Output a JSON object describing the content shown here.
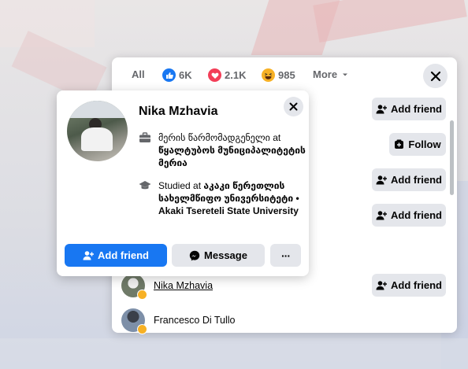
{
  "reactions_dialog": {
    "tabs": [
      {
        "label": "All"
      },
      {
        "label": "6K",
        "icon": "like-reaction-icon",
        "color": "#1877f2"
      },
      {
        "label": "2.1K",
        "icon": "love-reaction-icon",
        "color": "#f33e58"
      },
      {
        "label": "985",
        "icon": "haha-reaction-icon",
        "color": "#f7b125"
      },
      {
        "label": "More",
        "icon": "caret-down-icon"
      }
    ],
    "active_tab_color": "#1877f2",
    "rows": [
      {
        "action": "Add friend"
      },
      {
        "action": "Follow"
      },
      {
        "action": "Add friend"
      },
      {
        "action": "Add friend"
      },
      {
        "name": "Nika Mzhavia",
        "action": "Add friend",
        "reaction": "haha"
      },
      {
        "name": "Francesco Di Tullo",
        "reaction": "haha"
      }
    ]
  },
  "hover_card": {
    "name": "Nika Mzhavia",
    "work_prefix": "მერის წარმომადგენელი at",
    "work_place": "წყალტუბოს მუნიციპალიტეტის მერია",
    "education_prefix": "Studied at",
    "education_place": "აკაკი წერეთლის სახელმწიფო უნივერსიტეტი • Akaki Tsereteli State University",
    "add_friend_label": "Add friend",
    "message_label": "Message",
    "more_label": "···"
  },
  "colors": {
    "primary_button": "#1877f2",
    "secondary_button": "#e4e6eb"
  }
}
